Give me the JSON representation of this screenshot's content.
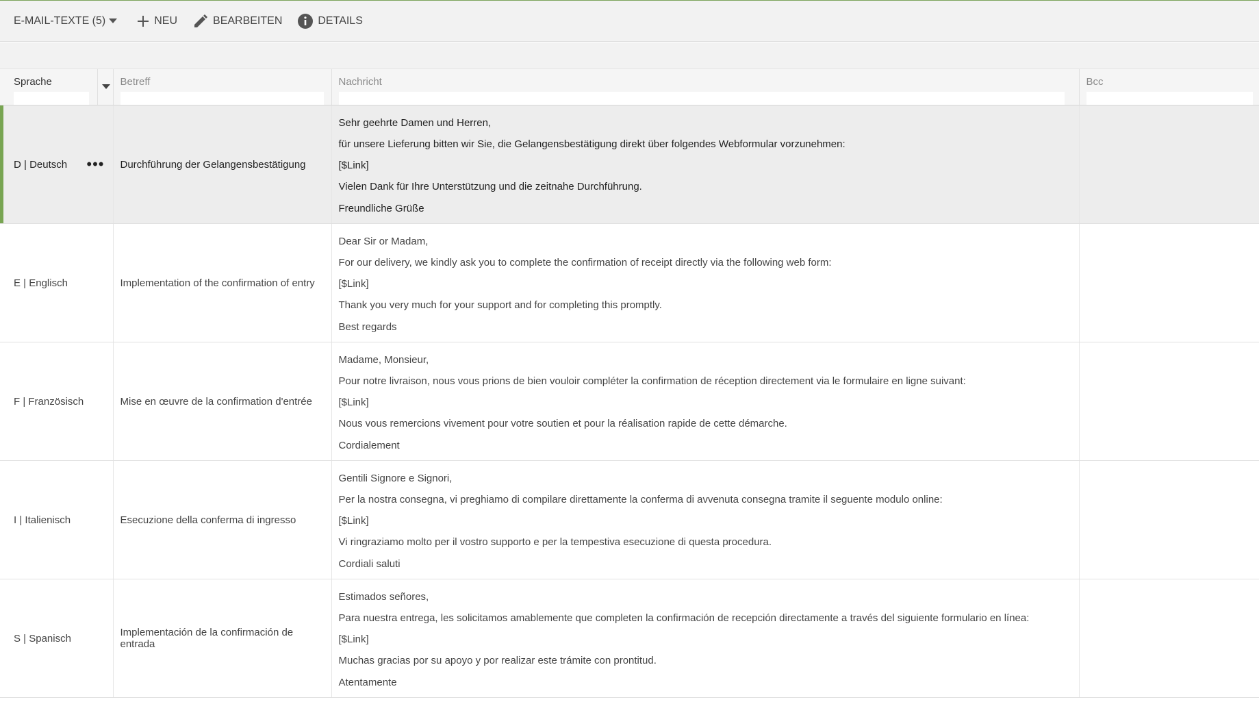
{
  "toolbar": {
    "title": "E-MAIL-TEXTE (5)",
    "new_label": "NEU",
    "edit_label": "BEARBEITEN",
    "details_label": "DETAILS"
  },
  "columns": {
    "language": "Sprache",
    "subject": "Betreff",
    "message": "Nachricht",
    "bcc": "Bcc"
  },
  "rows": [
    {
      "language": "D | Deutsch",
      "subject": "Durchführung der Gelangensbestätigung",
      "lines": [
        "Sehr geehrte Damen und Herren,",
        "für unsere Lieferung bitten wir Sie, die Gelangensbestätigung direkt über folgendes Webformular vorzunehmen:",
        "[$Link]",
        "Vielen Dank für Ihre Unterstützung und die zeitnahe Durchführung.",
        "Freundliche Grüße"
      ],
      "bcc": ""
    },
    {
      "language": "E | Englisch",
      "subject": "Implementation of the confirmation of entry",
      "lines": [
        "Dear Sir or Madam,",
        "For our delivery, we kindly ask you to complete the confirmation of receipt directly via the following web form:",
        "[$Link]",
        "Thank you very much for your support and for completing this promptly.",
        "Best regards"
      ],
      "bcc": ""
    },
    {
      "language": "F | Französisch",
      "subject": "Mise en œuvre de la confirmation d'entrée",
      "lines": [
        "Madame, Monsieur,",
        "Pour notre livraison, nous vous prions de bien vouloir compléter la confirmation de réception directement via le formulaire en ligne suivant:",
        "[$Link]",
        "Nous vous remercions vivement pour votre soutien et pour la réalisation rapide de cette démarche.",
        "Cordialement"
      ],
      "bcc": ""
    },
    {
      "language": "I | Italienisch",
      "subject": "Esecuzione della conferma di ingresso",
      "lines": [
        "Gentili Signore e Signori,",
        "Per la nostra consegna, vi preghiamo di compilare direttamente la conferma di avvenuta consegna tramite il seguente modulo online:",
        "[$Link]",
        "Vi ringraziamo molto per il vostro supporto e per la tempestiva esecuzione di questa procedura.",
        "Cordiali saluti"
      ],
      "bcc": ""
    },
    {
      "language": "S | Spanisch",
      "subject": "Implementación de la confirmación de entrada",
      "lines": [
        "Estimados señores,",
        "Para nuestra entrega, les solicitamos amablemente que completen la confirmación de recepción directamente a través del siguiente formulario en línea:",
        "[$Link]",
        "Muchas gracias por su apoyo y por realizar este trámite con prontitud.",
        "Atentamente"
      ],
      "bcc": ""
    }
  ],
  "selected_row": 0,
  "colors": {
    "accent": "#78a552",
    "selected_bg": "#ededed"
  },
  "icons": [
    "chevron-down-icon",
    "plus-icon",
    "pencil-icon",
    "info-icon",
    "more-dots-icon"
  ]
}
